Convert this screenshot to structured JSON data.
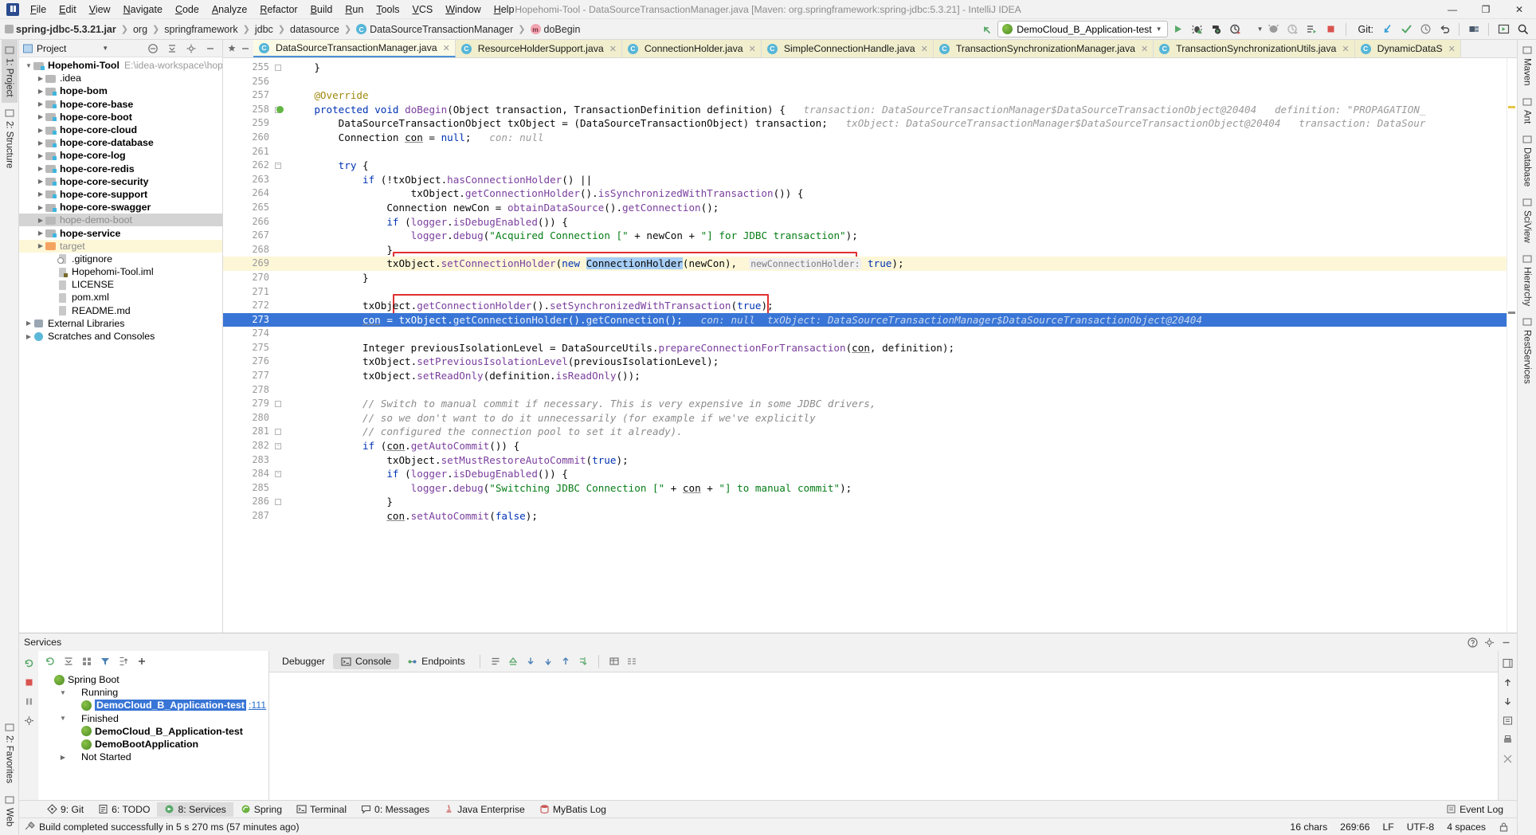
{
  "window": {
    "title": "Hopehomi-Tool - DataSourceTransactionManager.java [Maven: org.springframework:spring-jdbc:5.3.21] - IntelliJ IDEA",
    "minimize": "—",
    "maximize": "❐",
    "close": "✕"
  },
  "menu": [
    "File",
    "Edit",
    "View",
    "Navigate",
    "Code",
    "Analyze",
    "Refactor",
    "Build",
    "Run",
    "Tools",
    "VCS",
    "Window",
    "Help"
  ],
  "breadcrumb": [
    {
      "label": "spring-jdbc-5.3.21.jar",
      "icon": "jar-icon",
      "bold": true
    },
    {
      "label": "org",
      "icon": "",
      "bold": false
    },
    {
      "label": "springframework",
      "icon": "",
      "bold": false
    },
    {
      "label": "jdbc",
      "icon": "",
      "bold": false
    },
    {
      "label": "datasource",
      "icon": "",
      "bold": false
    },
    {
      "label": "DataSourceTransactionManager",
      "icon": "class-icon",
      "bold": false
    },
    {
      "label": "doBegin",
      "icon": "method-icon",
      "bold": false
    }
  ],
  "toolbar": {
    "run_config": "DemoCloud_B_Application-test",
    "git_label": "Git:",
    "icons": [
      "back-arrow-icon",
      "run-icon",
      "debug-icon",
      "run-with-coverage-icon",
      "profiler-icon",
      "attach-icon",
      "build-icon",
      "rerun-icon",
      "stop-icon",
      "update-project-icon",
      "commit-icon",
      "history-icon",
      "rollback-icon",
      "project-structure-icon",
      "select-in-icon",
      "search-everywhere-icon"
    ]
  },
  "project_panel": {
    "title": "Project",
    "header_icons": [
      "collapse-all-icon",
      "settings-icon",
      "hide-icon"
    ],
    "tree": [
      {
        "label": "Hopehomi-Tool",
        "path": "E:\\idea-workspace\\hopehom",
        "depth": 0,
        "arrow": "▼",
        "icon": "mod",
        "bold": true,
        "state": ""
      },
      {
        "label": ".idea",
        "path": "",
        "depth": 1,
        "arrow": "▶",
        "icon": "fold",
        "bold": false,
        "state": ""
      },
      {
        "label": "hope-bom",
        "path": "",
        "depth": 1,
        "arrow": "▶",
        "icon": "mod",
        "bold": true,
        "state": ""
      },
      {
        "label": "hope-core-base",
        "path": "",
        "depth": 1,
        "arrow": "▶",
        "icon": "mod",
        "bold": true,
        "state": ""
      },
      {
        "label": "hope-core-boot",
        "path": "",
        "depth": 1,
        "arrow": "▶",
        "icon": "mod",
        "bold": true,
        "state": ""
      },
      {
        "label": "hope-core-cloud",
        "path": "",
        "depth": 1,
        "arrow": "▶",
        "icon": "mod",
        "bold": true,
        "state": ""
      },
      {
        "label": "hope-core-database",
        "path": "",
        "depth": 1,
        "arrow": "▶",
        "icon": "mod",
        "bold": true,
        "state": ""
      },
      {
        "label": "hope-core-log",
        "path": "",
        "depth": 1,
        "arrow": "▶",
        "icon": "mod",
        "bold": true,
        "state": ""
      },
      {
        "label": "hope-core-redis",
        "path": "",
        "depth": 1,
        "arrow": "▶",
        "icon": "mod",
        "bold": true,
        "state": ""
      },
      {
        "label": "hope-core-security",
        "path": "",
        "depth": 1,
        "arrow": "▶",
        "icon": "mod",
        "bold": true,
        "state": ""
      },
      {
        "label": "hope-core-support",
        "path": "",
        "depth": 1,
        "arrow": "▶",
        "icon": "mod",
        "bold": true,
        "state": ""
      },
      {
        "label": "hope-core-swagger",
        "path": "",
        "depth": 1,
        "arrow": "▶",
        "icon": "mod",
        "bold": true,
        "state": ""
      },
      {
        "label": "hope-demo-boot",
        "path": "",
        "depth": 1,
        "arrow": "▶",
        "icon": "fold",
        "bold": false,
        "state": "sel"
      },
      {
        "label": "hope-service",
        "path": "",
        "depth": 1,
        "arrow": "▶",
        "icon": "mod",
        "bold": true,
        "state": ""
      },
      {
        "label": "target",
        "path": "",
        "depth": 1,
        "arrow": "▶",
        "icon": "orange",
        "bold": false,
        "state": "hl"
      },
      {
        "label": ".gitignore",
        "path": "",
        "depth": 2,
        "arrow": "",
        "icon": "file x",
        "bold": false,
        "state": ""
      },
      {
        "label": "Hopehomi-Tool.iml",
        "path": "",
        "depth": 2,
        "arrow": "",
        "icon": "file m",
        "bold": false,
        "state": ""
      },
      {
        "label": "LICENSE",
        "path": "",
        "depth": 2,
        "arrow": "",
        "icon": "file",
        "bold": false,
        "state": ""
      },
      {
        "label": "pom.xml",
        "path": "",
        "depth": 2,
        "arrow": "",
        "icon": "file",
        "bold": false,
        "state": ""
      },
      {
        "label": "README.md",
        "path": "",
        "depth": 2,
        "arrow": "",
        "icon": "file",
        "bold": false,
        "state": ""
      },
      {
        "label": "External Libraries",
        "path": "",
        "depth": 0,
        "arrow": "▶",
        "icon": "lib",
        "bold": false,
        "state": ""
      },
      {
        "label": "Scratches and Consoles",
        "path": "",
        "depth": 0,
        "arrow": "▶",
        "icon": "scratch",
        "bold": false,
        "state": ""
      }
    ]
  },
  "editor_tabs": [
    {
      "label": "DataSourceTransactionManager.java",
      "active": true
    },
    {
      "label": "ResourceHolderSupport.java",
      "active": false
    },
    {
      "label": "ConnectionHolder.java",
      "active": false
    },
    {
      "label": "SimpleConnectionHandle.java",
      "active": false
    },
    {
      "label": "TransactionSynchronizationManager.java",
      "active": false
    },
    {
      "label": "TransactionSynchronizationUtils.java",
      "active": false
    },
    {
      "label": "DynamicDataS",
      "active": false
    }
  ],
  "code": {
    "first_line": 255,
    "lines": [
      {
        "n": 255,
        "indent": 2,
        "state": "",
        "fold": "end",
        "html": "    }"
      },
      {
        "n": 256,
        "indent": 0,
        "state": "",
        "fold": "",
        "html": ""
      },
      {
        "n": 257,
        "indent": 2,
        "state": "",
        "fold": "",
        "html": "    <span class='anno'>@Override</span>"
      },
      {
        "n": 258,
        "indent": 2,
        "state": "",
        "fold": "start",
        "bp": true,
        "html": "    <span class='kw'>protected</span> <span class='kw'>void</span> <span class='mth'>doBegin</span>(Object transaction, TransactionDefinition definition) {   <span class='hint'>transaction: DataSourceTransactionManager$DataSourceTransactionObject@20404   definition: \"PROPAGATION_</span>"
      },
      {
        "n": 259,
        "indent": 3,
        "state": "",
        "fold": "",
        "html": "        DataSourceTransactionObject txObject = (DataSourceTransactionObject) transaction;   <span class='hint'>txObject: DataSourceTransactionManager$DataSourceTransactionObject@20404   transaction: DataSour</span>"
      },
      {
        "n": 260,
        "indent": 3,
        "state": "",
        "fold": "",
        "html": "        Connection <span class='underl'>con</span> = <span class='kw'>null</span>;   <span class='hint'>con: null</span>"
      },
      {
        "n": 261,
        "indent": 0,
        "state": "",
        "fold": "",
        "html": ""
      },
      {
        "n": 262,
        "indent": 3,
        "state": "",
        "fold": "start",
        "html": "        <span class='kw'>try</span> {"
      },
      {
        "n": 263,
        "indent": 4,
        "state": "",
        "fold": "",
        "html": "            <span class='kw'>if</span> (!txObject.<span class='mth'>hasConnectionHolder</span>() ||"
      },
      {
        "n": 264,
        "indent": 5,
        "state": "",
        "fold": "",
        "html": "                    txObject.<span class='mth'>getConnectionHolder</span>().<span class='mth'>isSynchronizedWithTransaction</span>()) {"
      },
      {
        "n": 265,
        "indent": 5,
        "state": "",
        "fold": "",
        "html": "                Connection newCon = <span class='mth'>obtainDataSource</span>().<span class='mth'>getConnection</span>();"
      },
      {
        "n": 266,
        "indent": 5,
        "state": "",
        "fold": "",
        "html": "                <span class='kw'>if</span> (<span class='field'>logger</span>.<span class='mth'>isDebugEnabled</span>()) {"
      },
      {
        "n": 267,
        "indent": 6,
        "state": "",
        "fold": "",
        "html": "                    <span class='field'>logger</span>.<span class='mth'>debug</span>(<span class='str'>\"Acquired Connection [\"</span> + newCon + <span class='str'>\"] for JDBC transaction\"</span>);"
      },
      {
        "n": 268,
        "indent": 5,
        "state": "",
        "fold": "",
        "html": "                }"
      },
      {
        "n": 269,
        "indent": 5,
        "state": "hl",
        "fold": "",
        "html": "                txObject.<span class='mth'>setConnectionHolder</span>(<span class='kw'>new</span> <span class='selhl'>ConnectionHolder</span>(newCon),  <span class='hintbg'>newConnectionHolder:</span> <span class='kw'>true</span>);"
      },
      {
        "n": 270,
        "indent": 4,
        "state": "",
        "fold": "",
        "html": "            }"
      },
      {
        "n": 271,
        "indent": 0,
        "state": "",
        "fold": "",
        "html": ""
      },
      {
        "n": 272,
        "indent": 4,
        "state": "",
        "fold": "",
        "html": "            txObject.<span class='mth'>getConnectionHolder</span>().<span class='mth'>setSynchronizedWithTransaction</span>(<span class='kw'>true</span>);"
      },
      {
        "n": 273,
        "indent": 4,
        "state": "cur",
        "fold": "",
        "html": "            <span class='underl'>con</span> = txObject.<span class='mth'>getConnectionHolder</span>().<span class='mth'>getConnection</span>();   <span class='hint'>con: null  txObject: DataSourceTransactionManager$DataSourceTransactionObject@20404</span>"
      },
      {
        "n": 274,
        "indent": 0,
        "state": "",
        "fold": "",
        "html": ""
      },
      {
        "n": 275,
        "indent": 4,
        "state": "",
        "fold": "",
        "html": "            Integer previousIsolationLevel = DataSourceUtils.<span class='mth'>prepareConnectionForTransaction</span>(<span class='underl'>con</span>, definition);"
      },
      {
        "n": 276,
        "indent": 4,
        "state": "",
        "fold": "",
        "html": "            txObject.<span class='mth'>setPreviousIsolationLevel</span>(previousIsolationLevel);"
      },
      {
        "n": 277,
        "indent": 4,
        "state": "",
        "fold": "",
        "html": "            txObject.<span class='mth'>setReadOnly</span>(definition.<span class='mth'>isReadOnly</span>());"
      },
      {
        "n": 278,
        "indent": 0,
        "state": "",
        "fold": "",
        "html": ""
      },
      {
        "n": 279,
        "indent": 4,
        "state": "",
        "fold": "end",
        "html": "            <span class='cmt'>// Switch to manual commit if necessary. This is very expensive in some JDBC drivers,</span>"
      },
      {
        "n": 280,
        "indent": 4,
        "state": "",
        "fold": "",
        "html": "            <span class='cmt'>// so we don't want to do it unnecessarily (for example if we've explicitly</span>"
      },
      {
        "n": 281,
        "indent": 4,
        "state": "",
        "fold": "end",
        "html": "            <span class='cmt'>// configured the connection pool to set it already).</span>"
      },
      {
        "n": 282,
        "indent": 4,
        "state": "",
        "fold": "start",
        "html": "            <span class='kw'>if</span> (<span class='underl'>con</span>.<span class='mth'>getAutoCommit</span>()) {"
      },
      {
        "n": 283,
        "indent": 5,
        "state": "",
        "fold": "",
        "html": "                txObject.<span class='mth'>setMustRestoreAutoCommit</span>(<span class='kw'>true</span>);"
      },
      {
        "n": 284,
        "indent": 5,
        "state": "",
        "fold": "start",
        "html": "                <span class='kw'>if</span> (<span class='field'>logger</span>.<span class='mth'>isDebugEnabled</span>()) {"
      },
      {
        "n": 285,
        "indent": 6,
        "state": "",
        "fold": "",
        "html": "                    <span class='field'>logger</span>.<span class='mth'>debug</span>(<span class='str'>\"Switching JDBC Connection [\"</span> + <span class='underl'>con</span> + <span class='str'>\"] to manual commit\"</span>);"
      },
      {
        "n": 286,
        "indent": 5,
        "state": "",
        "fold": "end",
        "html": "                }"
      },
      {
        "n": 287,
        "indent": 5,
        "state": "",
        "fold": "",
        "html": "                <span class='underl'>con</span>.<span class='mth'>setAutoCommit</span>(<span class='kw'>false</span>);"
      }
    ]
  },
  "services": {
    "title": "Services",
    "tree": [
      {
        "label": "Spring Boot",
        "depth": 0,
        "arrow": "",
        "icon": "svc-ico",
        "bold": false,
        "suffix": "",
        "sel": false
      },
      {
        "label": "Running",
        "depth": 1,
        "arrow": "▼",
        "icon": "plain",
        "bold": false,
        "suffix": "",
        "sel": false
      },
      {
        "label": "DemoCloud_B_Application-test",
        "depth": 2,
        "arrow": "",
        "icon": "svc-ico",
        "bold": true,
        "suffix": ":111",
        "sel": true
      },
      {
        "label": "Finished",
        "depth": 1,
        "arrow": "▼",
        "icon": "plain",
        "bold": false,
        "suffix": "",
        "sel": false
      },
      {
        "label": "DemoCloud_B_Application-test",
        "depth": 2,
        "arrow": "",
        "icon": "svc-ico",
        "bold": true,
        "suffix": "",
        "sel": false
      },
      {
        "label": "DemoBootApplication",
        "depth": 2,
        "arrow": "",
        "icon": "svc-ico",
        "bold": true,
        "suffix": "",
        "sel": false
      },
      {
        "label": "Not Started",
        "depth": 1,
        "arrow": "▶",
        "icon": "plain",
        "bold": false,
        "suffix": "",
        "sel": false
      }
    ],
    "tabs": [
      {
        "label": "Debugger",
        "icon": "",
        "active": false
      },
      {
        "label": "Console",
        "icon": "console-icon",
        "active": true
      },
      {
        "label": "Endpoints",
        "icon": "endpoints-icon",
        "active": false
      }
    ]
  },
  "bottom_tools": [
    {
      "label": "9: Git",
      "icon": "git-icon",
      "active": false
    },
    {
      "label": "6: TODO",
      "icon": "todo-icon",
      "active": false
    },
    {
      "label": "8: Services",
      "icon": "services-icon",
      "active": true
    },
    {
      "label": "Spring",
      "icon": "spring-icon",
      "active": false
    },
    {
      "label": "Terminal",
      "icon": "terminal-icon",
      "active": false
    },
    {
      "label": "0: Messages",
      "icon": "messages-icon",
      "active": false
    },
    {
      "label": "Java Enterprise",
      "icon": "java-ee-icon",
      "active": false
    },
    {
      "label": "MyBatis Log",
      "icon": "mybatis-icon",
      "active": false
    }
  ],
  "bottom_right": {
    "label": "Event Log",
    "icon": "event-log-icon"
  },
  "left_rail": [
    {
      "label": "1: Project",
      "icon": "project-icon",
      "active": true
    },
    {
      "label": "2: Structure",
      "icon": "structure-icon",
      "active": false
    }
  ],
  "left_rail_bottom": [
    {
      "label": "2: Favorites",
      "icon": "favorites-icon",
      "active": false
    },
    {
      "label": "Web",
      "icon": "web-icon",
      "active": false
    }
  ],
  "right_rail": [
    {
      "label": "Maven",
      "icon": "maven-icon",
      "active": false
    },
    {
      "label": "Ant",
      "icon": "ant-icon",
      "active": false
    },
    {
      "label": "Database",
      "icon": "database-icon",
      "active": false
    },
    {
      "label": "SciView",
      "icon": "sciview-icon",
      "active": false
    },
    {
      "label": "Hierarchy",
      "icon": "hierarchy-icon",
      "active": false
    },
    {
      "label": "RestServices",
      "icon": "rest-services-icon",
      "active": false
    }
  ],
  "status": {
    "message": "Build completed successfully in 5 s 270 ms (57 minutes ago)",
    "chars": "16 chars",
    "caret": "269:66",
    "line_sep": "LF",
    "encoding": "UTF-8",
    "indent": "4 spaces",
    "lock": "lock-icon"
  }
}
